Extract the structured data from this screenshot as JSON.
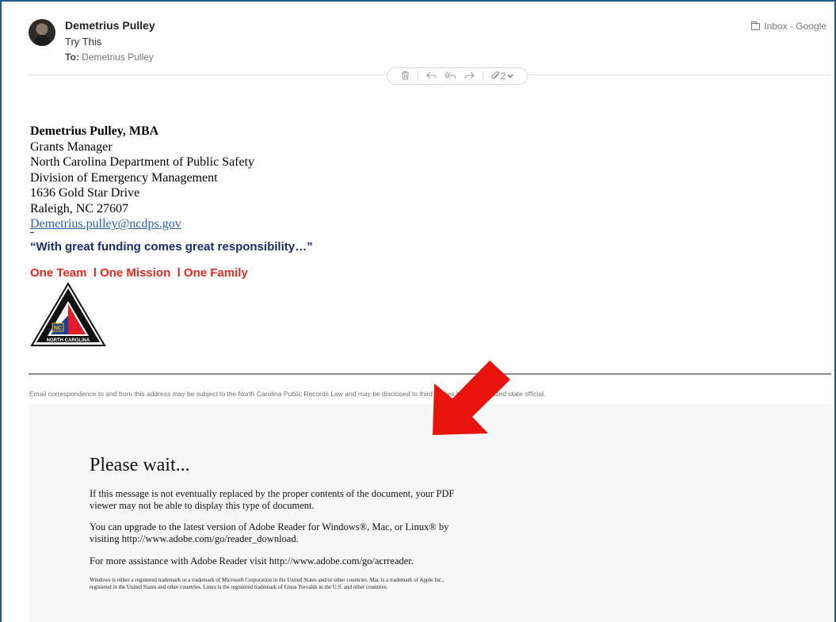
{
  "header": {
    "sender_name": "Demetrius Pulley",
    "subject": "Try This",
    "to_label": "To:",
    "to_value": "Demetrius Pulley",
    "mailbox": "Inbox - Google",
    "attachment_count": "2"
  },
  "toolbar": {
    "icons": [
      "trash-icon",
      "reply-icon",
      "reply-all-icon",
      "forward-icon",
      "attachment-icon"
    ]
  },
  "signature": {
    "name": "Demetrius Pulley, MBA",
    "title": "Grants Manager",
    "department": "North Carolina Department of Public Safety",
    "division": "Division of Emergency Management",
    "street": "1636 Gold Star Drive",
    "city": "Raleigh, NC 27607",
    "email": "Demetrius.pulley@ncdps.gov",
    "quote": "“With great funding comes great responsibility…”",
    "motto": "One Team  l One Mission  l One Family"
  },
  "disclaimer": "Email correspondence to and from this address may be subject to the North Carolina Public Records Law and may be disclosed to third parties by an authorized state official.",
  "pdf": {
    "title": "Please wait...",
    "p1": "If this message is not eventually replaced by the proper contents of the document, your PDF viewer may not be able to display this type of document.",
    "p2": "You can upgrade to the latest version of Adobe Reader for Windows®, Mac, or Linux® by visiting  http://www.adobe.com/go/reader_download.",
    "p3": "For more assistance with Adobe Reader visit  http://www.adobe.com/go/acrreader.",
    "fine_print": "Windows is either a registered trademark or a trademark of Microsoft Corporation in the United States and/or other countries. Mac is a trademark of Apple Inc., registered in the United States and other countries. Linux is the registered trademark of Linus Torvalds in the U.S. and other countries."
  },
  "colors": {
    "frame_border": "#1f5a8a",
    "quote": "#1a2a6c",
    "motto": "#e8281e",
    "arrow": "#e8140c",
    "link": "#2a5ea8"
  }
}
